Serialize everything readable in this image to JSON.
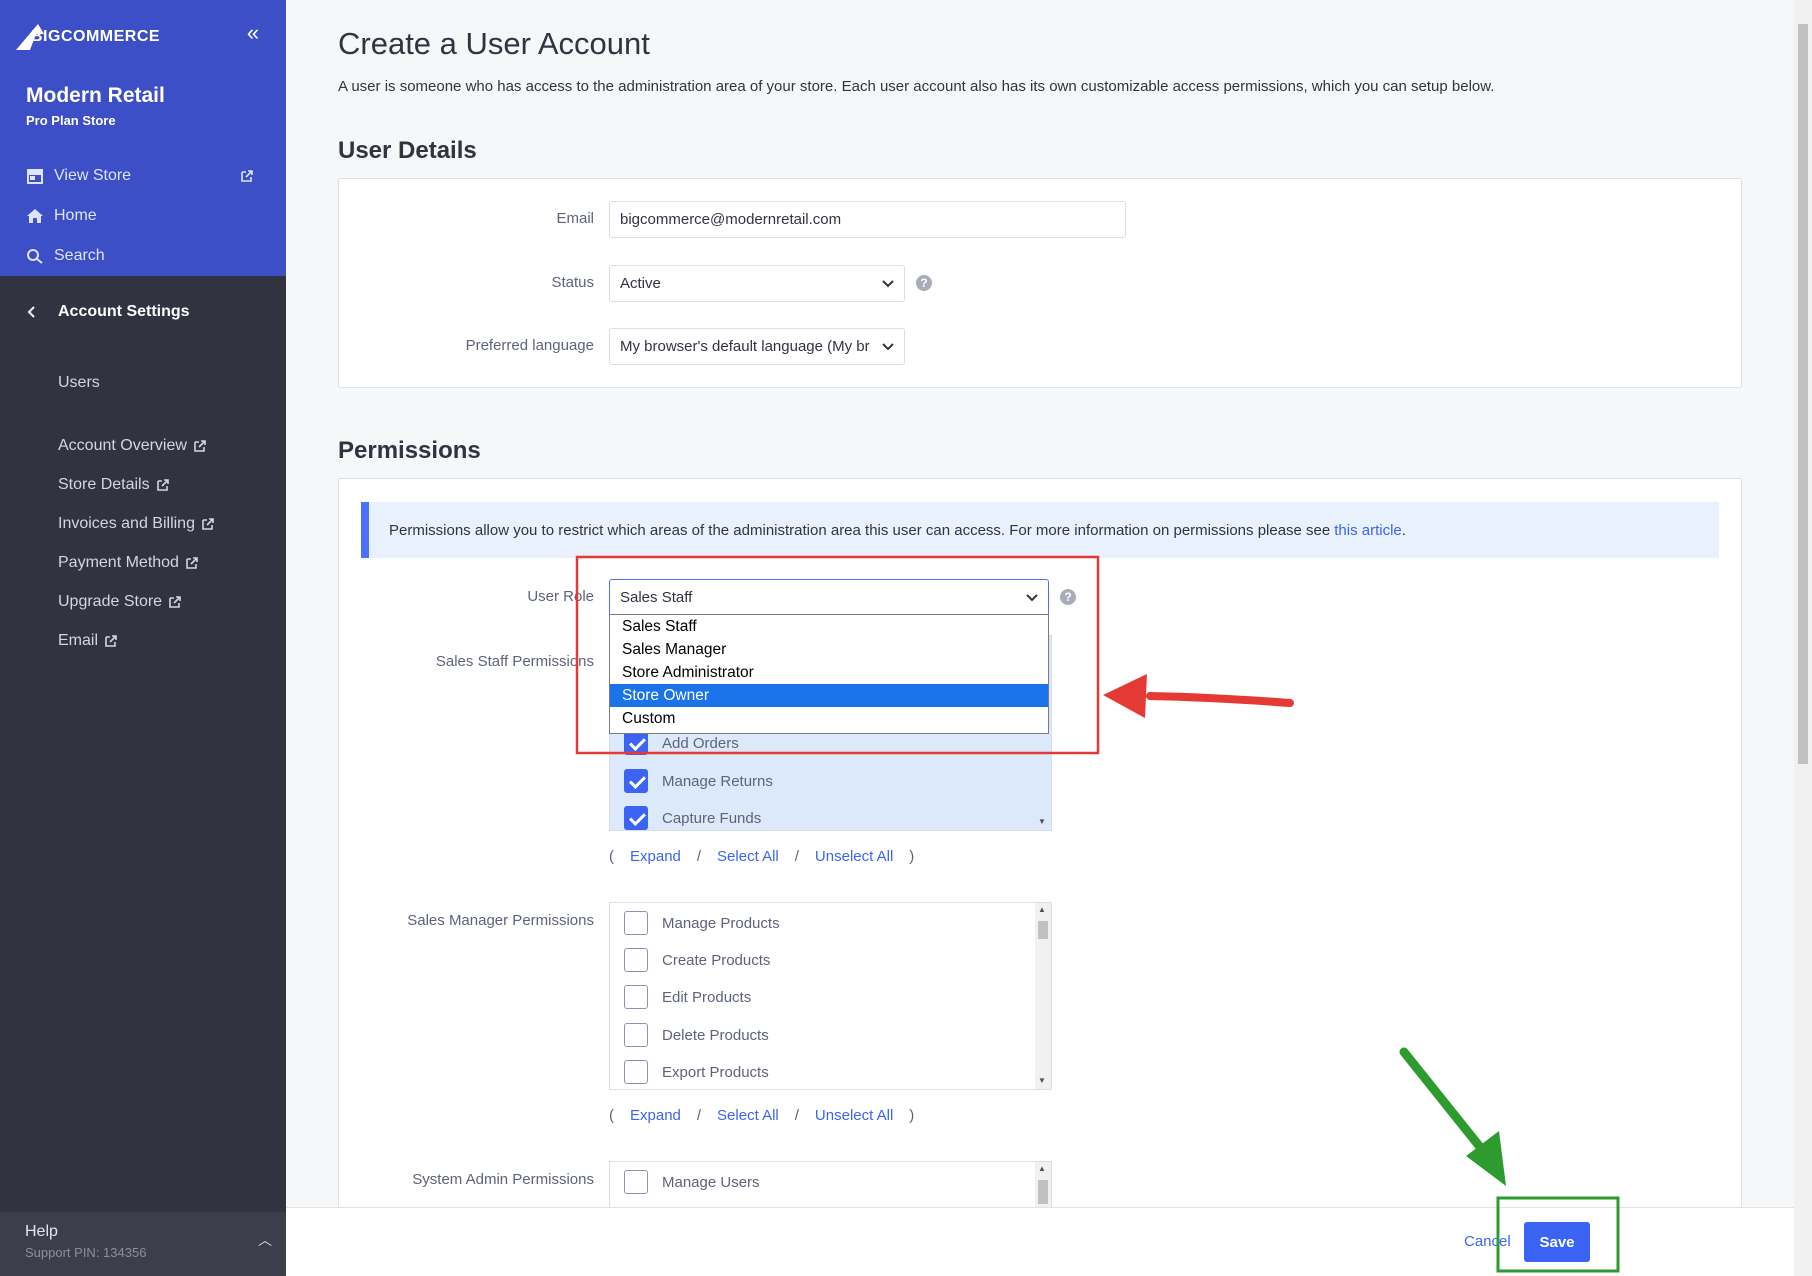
{
  "sidebar": {
    "logo_text": "BIGCOMMERCE",
    "store_name": "Modern Retail",
    "store_plan": "Pro Plan Store",
    "nav": [
      {
        "label": "View Store",
        "icon": "storefront-icon"
      },
      {
        "label": "Home",
        "icon": "home-icon"
      },
      {
        "label": "Search",
        "icon": "search-icon"
      }
    ],
    "section_title": "Account Settings",
    "items": [
      {
        "label": "Users"
      },
      {
        "label": "Account Overview"
      },
      {
        "label": "Store Details"
      },
      {
        "label": "Invoices and Billing"
      },
      {
        "label": "Payment Method"
      },
      {
        "label": "Upgrade Store"
      },
      {
        "label": "Email"
      }
    ],
    "help": {
      "title": "Help",
      "pin": "Support PIN: 134356"
    }
  },
  "page": {
    "title": "Create a User Account",
    "description": "A user is someone who has access to the administration area of your store. Each user account also has its own customizable access permissions, which you can setup below."
  },
  "user_details": {
    "heading": "User Details",
    "email_label": "Email",
    "email_value": "bigcommerce@modernretail.com",
    "status_label": "Status",
    "status_value": "Active",
    "language_label": "Preferred language",
    "language_value": "My browser's default language (My br"
  },
  "permissions": {
    "heading": "Permissions",
    "info_text": "Permissions allow you to restrict which areas of the administration area this user can access. For more information on permissions please see",
    "info_link": "this article",
    "info_end": ".",
    "role_label": "User Role",
    "role_value": "Sales Staff",
    "role_options": [
      "Sales Staff",
      "Sales Manager",
      "Store Administrator",
      "Store Owner",
      "Custom"
    ],
    "role_selected_option": "Store Owner",
    "sales_staff_label": "Sales Staff Permissions",
    "sales_staff_items": [
      {
        "label": "Add Orders",
        "checked": true
      },
      {
        "label": "Manage Returns",
        "checked": true
      },
      {
        "label": "Capture Funds",
        "checked": true
      }
    ],
    "sales_manager_label": "Sales Manager Permissions",
    "sales_manager_items": [
      {
        "label": "Manage Products",
        "checked": false
      },
      {
        "label": "Create Products",
        "checked": false
      },
      {
        "label": "Edit Products",
        "checked": false
      },
      {
        "label": "Delete Products",
        "checked": false
      },
      {
        "label": "Export Products",
        "checked": false
      }
    ],
    "system_admin_label": "System Admin Permissions",
    "system_admin_items": [
      {
        "label": "Manage Users",
        "checked": false
      }
    ],
    "links": {
      "open": "(",
      "expand": "Expand",
      "sep": "/",
      "select_all": "Select All",
      "unselect_all": "Unselect All",
      "close": ")"
    }
  },
  "footer": {
    "cancel": "Cancel",
    "save": "Save"
  },
  "colors": {
    "sidebar_top": "#3c4fc6",
    "sidebar": "#313440",
    "accent": "#3c64f4",
    "annotation_red": "#e53935",
    "annotation_green": "#2e9b2e"
  }
}
